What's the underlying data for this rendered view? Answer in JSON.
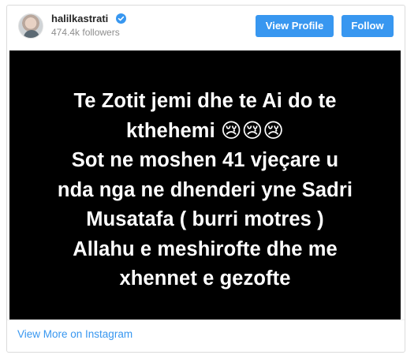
{
  "header": {
    "username": "halilkastrati",
    "followers": "474.4k followers",
    "view_profile_label": "View Profile",
    "follow_label": "Follow"
  },
  "post": {
    "lines": [
      "Te Zotit jemi dhe te Ai do te",
      "kthehemi 😢😢😢",
      "Sot ne moshen 41 vjeçare u",
      "nda nga ne dhenderi yne Sadri",
      "Musatafa ( burri motres )",
      "Allahu e meshirofte dhe me",
      "xhennet e gezofte"
    ]
  },
  "footer": {
    "view_more_label": "View More on Instagram"
  },
  "colors": {
    "accent": "#3897f0",
    "post_background": "#000000",
    "text_muted": "#8e8e8e"
  },
  "icons": {
    "verified": "verified-badge-icon"
  }
}
